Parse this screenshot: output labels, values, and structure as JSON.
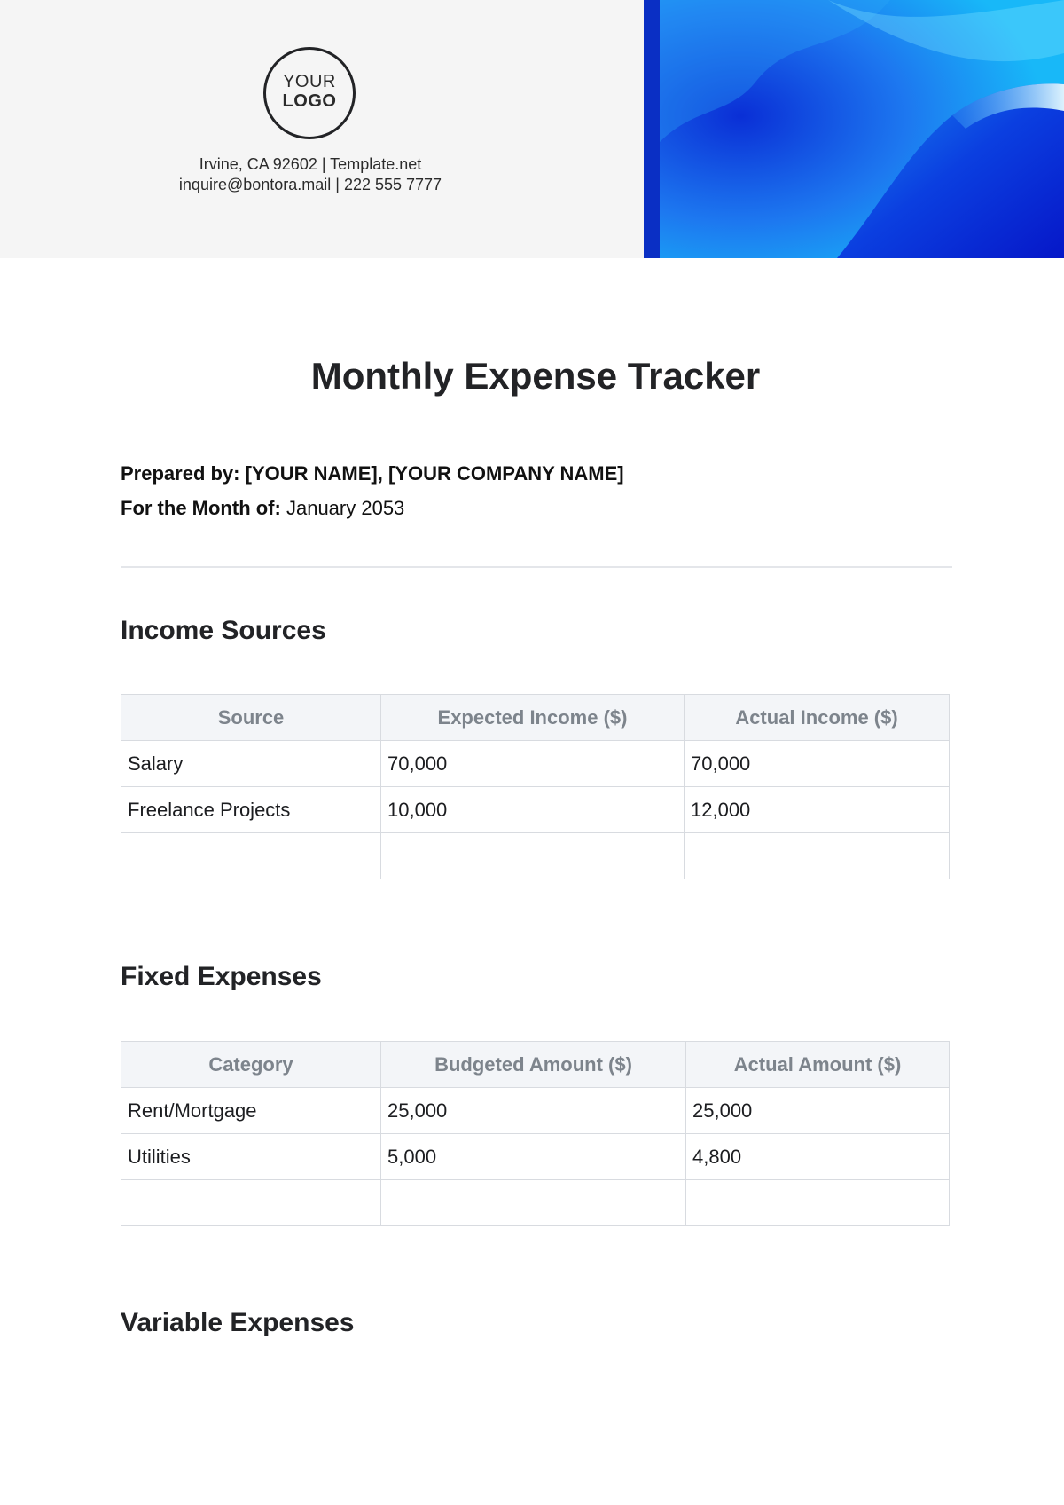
{
  "header": {
    "logo_line1": "YOUR",
    "logo_line2": "LOGO",
    "address_line": "Irvine, CA 92602 | Template.net",
    "contact_line": "inquire@bontora.mail | 222 555 7777"
  },
  "document": {
    "title": "Monthly Expense Tracker",
    "prepared_by_label": "Prepared by:",
    "prepared_by_value": "[YOUR NAME], [YOUR COMPANY NAME]",
    "month_label": "For the Month of:",
    "month_value": "January 2053"
  },
  "income": {
    "title": "Income Sources",
    "headers": [
      "Source",
      "Expected Income ($)",
      "Actual Income ($)"
    ],
    "rows": [
      [
        "Salary",
        "70,000",
        "70,000"
      ],
      [
        "Freelance Projects",
        "10,000",
        "12,000"
      ],
      [
        "",
        "",
        ""
      ]
    ]
  },
  "fixed": {
    "title": "Fixed Expenses",
    "headers": [
      "Category",
      "Budgeted Amount ($)",
      "Actual Amount ($)"
    ],
    "rows": [
      [
        "Rent/Mortgage",
        "25,000",
        "25,000"
      ],
      [
        "Utilities",
        "5,000",
        "4,800"
      ],
      [
        "",
        "",
        ""
      ]
    ]
  },
  "variable": {
    "title": "Variable Expenses"
  },
  "colors": {
    "header_bg": "#f5f5f5",
    "accent_blue": "#0a2fc4",
    "table_header_bg": "#f3f5f8",
    "table_header_text": "#7d848c"
  }
}
